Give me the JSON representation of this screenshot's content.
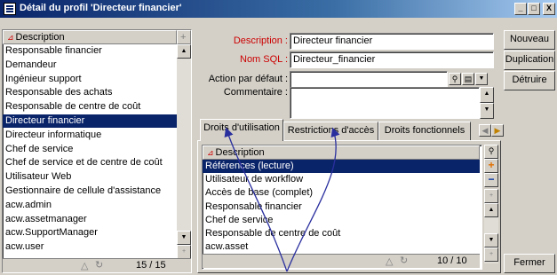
{
  "window": {
    "title": "Détail du profil 'Directeur financier'",
    "min": "_",
    "max": "□",
    "close": "X"
  },
  "left_list": {
    "header": "Description",
    "items": [
      "Responsable financier",
      "Demandeur",
      "Ingénieur support",
      "Responsable des achats",
      "Responsable de centre de coût",
      "Directeur financier",
      "Directeur informatique",
      "Chef de service",
      "Chef de service et de centre de coût",
      "Utilisateur Web",
      "Gestionnaire de cellule d'assistance",
      "acw.admin",
      "acw.assetmanager",
      "acw.SupportManager",
      "acw.user"
    ],
    "selected_index": 5,
    "count": "15 / 15"
  },
  "form": {
    "description_label": "Description :",
    "description_value": "Directeur financier",
    "sqlname_label": "Nom SQL :",
    "sqlname_value": "Directeur_financier",
    "default_action_label": "Action par défaut :",
    "default_action_value": "",
    "comment_label": "Commentaire :",
    "comment_value": ""
  },
  "tabs": [
    {
      "label": "Droits d'utilisation",
      "active": true
    },
    {
      "label": "Restrictions d'accès",
      "active": false
    },
    {
      "label": "Droits fonctionnels",
      "active": false
    }
  ],
  "tab_list": {
    "header": "Description",
    "items": [
      "Références (lecture)",
      "Utilisateur de workflow",
      "Accès de base (complet)",
      "Responsable financier",
      "Chef de service",
      "Responsable de centre de coût",
      "acw.asset"
    ],
    "selected_index": 0,
    "count": "10 / 10"
  },
  "buttons": {
    "new": "Nouveau",
    "duplicate": "Duplication",
    "delete": "Détruire",
    "close": "Fermer"
  },
  "colors": {
    "selection": "#0a246a",
    "mandatory_label": "#cc0000",
    "annotation": "#2a2f9e"
  }
}
